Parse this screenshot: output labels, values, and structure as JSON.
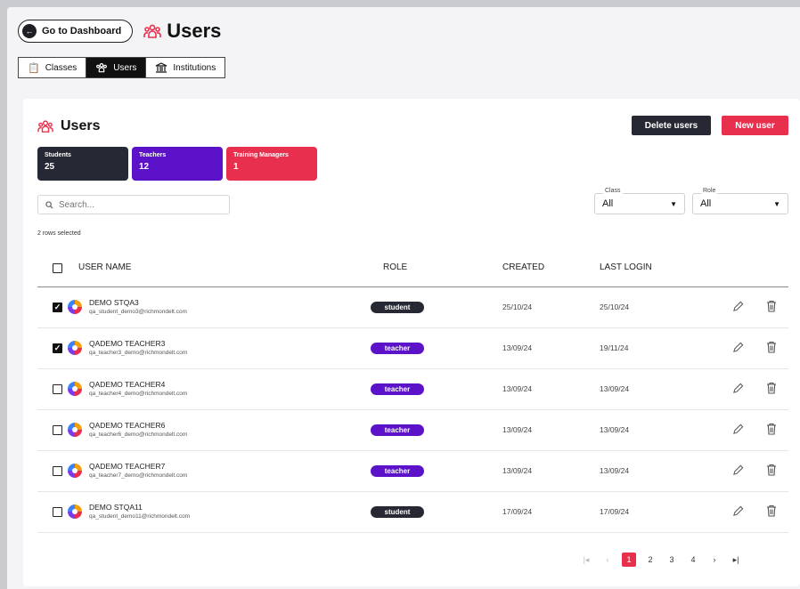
{
  "header": {
    "back_label": "Go to Dashboard",
    "title": "Users"
  },
  "tabs": [
    {
      "label": "Classes",
      "icon": "clipboard-icon",
      "active": false
    },
    {
      "label": "Users",
      "icon": "users-icon",
      "active": true
    },
    {
      "label": "Institutions",
      "icon": "institution-icon",
      "active": false
    }
  ],
  "card": {
    "title": "Users",
    "delete_label": "Delete users",
    "new_label": "New user"
  },
  "stats": [
    {
      "label": "Students",
      "value": "25"
    },
    {
      "label": "Teachers",
      "value": "12"
    },
    {
      "label": "Training Managers",
      "value": "1"
    }
  ],
  "search": {
    "placeholder": "Search..."
  },
  "filters": {
    "class_label": "Class",
    "class_value": "All",
    "role_label": "Role",
    "role_value": "All"
  },
  "rows_selected": "2 rows selected",
  "table": {
    "columns": [
      "USER NAME",
      "ROLE",
      "CREATED",
      "LAST LOGIN"
    ],
    "rows": [
      {
        "name": "DEMO STQA3",
        "email": "qa_student_demo3@richmondelt.com",
        "role": "student",
        "created": "25/10/24",
        "last_login": "25/10/24",
        "checked": true
      },
      {
        "name": "QADEMO TEACHER3",
        "email": "qa_teacher3_demo@richmondelt.com",
        "role": "teacher",
        "created": "13/09/24",
        "last_login": "19/11/24",
        "checked": true
      },
      {
        "name": "QADEMO TEACHER4",
        "email": "qa_teacher4_demo@richmondelt.com",
        "role": "teacher",
        "created": "13/09/24",
        "last_login": "13/09/24",
        "checked": false
      },
      {
        "name": "QADEMO TEACHER6",
        "email": "qa_teacher6_demo@richmondelt.com",
        "role": "teacher",
        "created": "13/09/24",
        "last_login": "13/09/24",
        "checked": false
      },
      {
        "name": "QADEMO TEACHER7",
        "email": "qa_teacher7_demo@richmondelt.com",
        "role": "teacher",
        "created": "13/09/24",
        "last_login": "13/09/24",
        "checked": false
      },
      {
        "name": "DEMO STQA11",
        "email": "qa_student_demo11@richmondelt.com",
        "role": "student",
        "created": "17/09/24",
        "last_login": "17/09/24",
        "checked": false
      }
    ]
  },
  "pagination": {
    "first": "|◂",
    "prev": "‹",
    "pages": [
      "1",
      "2",
      "3",
      "4"
    ],
    "current": "1",
    "next": "›",
    "last": "▸|"
  },
  "colors": {
    "accent": "#e8304e",
    "dark": "#262833",
    "purple": "#5b12c9"
  }
}
